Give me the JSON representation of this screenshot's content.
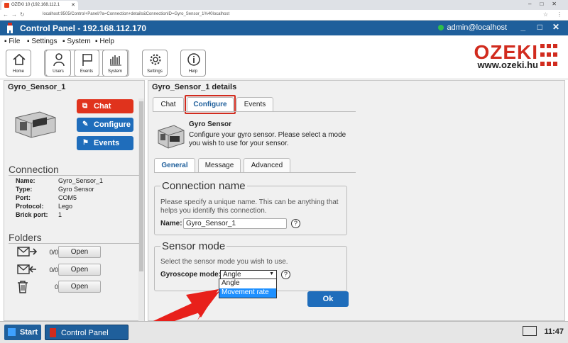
{
  "browser": {
    "tab_title": "OZEKI 10 (192.168.112.1",
    "url": "localhost:9505/Control+Panel/?a=Connection+details&ConnectionID=Gyro_Sensor_1%40localhost"
  },
  "app": {
    "title": "Control Panel - 192.168.112.170",
    "user": "admin@localhost",
    "win_min": "_",
    "win_max": "□",
    "win_close": "✕"
  },
  "menu": [
    "▪ File",
    "▪ Settings",
    "▪ System",
    "▪ Help"
  ],
  "toolbar": {
    "home": "Home",
    "users": "Users",
    "events": "Events",
    "system": "System",
    "settings": "Settings",
    "help": "Help"
  },
  "brand": {
    "name": "OZEKI",
    "url": "www.ozeki.hu"
  },
  "left": {
    "title": "Gyro_Sensor_1",
    "buttons": {
      "chat": "Chat",
      "configure": "Configure",
      "events": "Events"
    },
    "connection_title": "Connection",
    "props": [
      {
        "k": "Name:",
        "v": "Gyro_Sensor_1"
      },
      {
        "k": "Type:",
        "v": "Gyro Sensor"
      },
      {
        "k": "Port:",
        "v": "COM5"
      },
      {
        "k": "Protocol:",
        "v": "Lego"
      },
      {
        "k": "Brick port:",
        "v": "1"
      }
    ],
    "folders_title": "Folders",
    "folders": [
      {
        "count": "0/0",
        "btn": "Open"
      },
      {
        "count": "0/0",
        "btn": "Open"
      },
      {
        "count": "0",
        "btn": "Open"
      }
    ]
  },
  "right": {
    "title": "Gyro_Sensor_1 details",
    "tabs": [
      "Chat",
      "Configure",
      "Events"
    ],
    "device_title": "Gyro Sensor",
    "device_desc": "Configure your gyro sensor. Please select a mode you wish to use for your sensor.",
    "subtabs": [
      "General",
      "Message",
      "Advanced"
    ],
    "conn_name": {
      "title": "Connection name",
      "text": "Please specify a unique name. This can be anything that helps you identify this connection.",
      "label": "Name:",
      "value": "Gyro_Sensor_1"
    },
    "sensor_mode": {
      "title": "Sensor mode",
      "text": "Select the sensor mode you wish to use.",
      "label": "Gyroscope mode:",
      "value": "Angle",
      "options": [
        "Angle",
        "Movement rate"
      ]
    },
    "ok": "Ok"
  },
  "taskbar": {
    "start": "Start",
    "item": "Control Panel",
    "clock": "11:47"
  }
}
